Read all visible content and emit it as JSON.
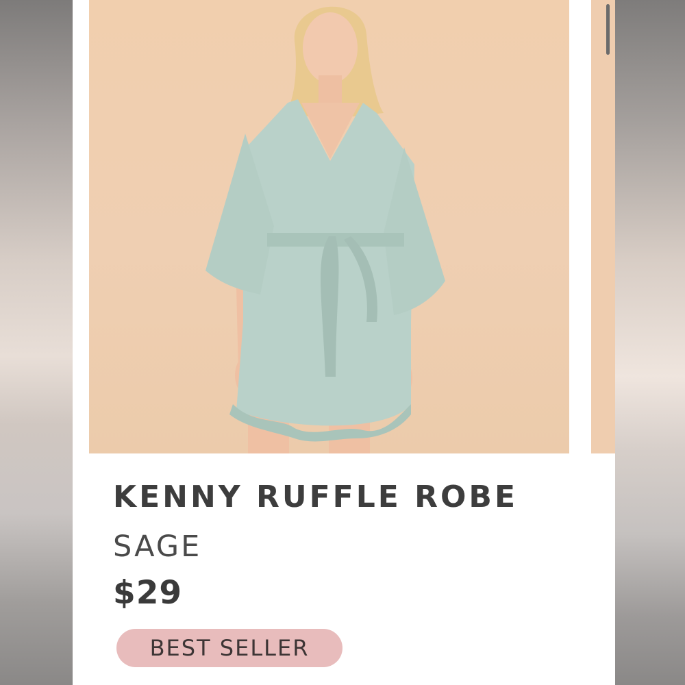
{
  "product": {
    "name": "KENNY RUFFLE ROBE",
    "color": "SAGE",
    "price": "$29",
    "badge": "BEST SELLER"
  },
  "colors": {
    "backdrop": "#efcfb2",
    "robe": "#b9d1c9",
    "badge": "#e8bcbc"
  }
}
